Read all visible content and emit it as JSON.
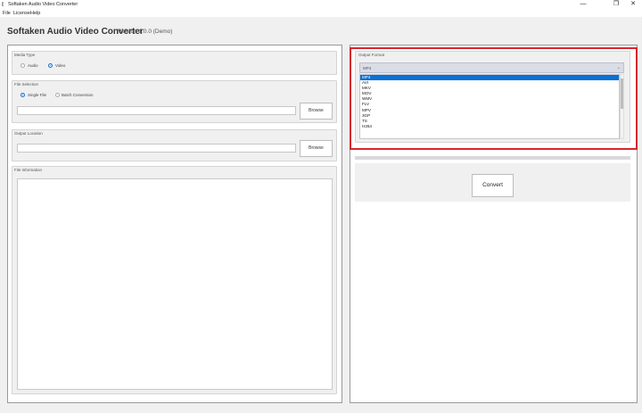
{
  "window": {
    "title": "Softaken Audio Video Converter",
    "minimize_glyph": "—",
    "restore_glyph": "❐",
    "close_glyph": "✕"
  },
  "menu": {
    "items": [
      "File",
      "License",
      "Help"
    ]
  },
  "header": {
    "title": "Softaken Audio Video Converter",
    "version": "Version 1.0.0 (Demo)"
  },
  "media_type": {
    "label": "Media Type",
    "options": [
      "Audio",
      "Video"
    ],
    "selected": "Video"
  },
  "file_selection": {
    "label": "File Selection",
    "options": [
      "Single File",
      "Batch Conversion"
    ],
    "selected": "Single File",
    "path": "",
    "browse_label": "Browse"
  },
  "output_location": {
    "label": "Output Location",
    "path": "",
    "browse_label": "Browse"
  },
  "file_information": {
    "label": "File Information",
    "content": ""
  },
  "output_format": {
    "label": "Output Format",
    "selected": "MP4",
    "options": [
      "MP4",
      "AVI",
      "MKV",
      "MOV",
      "WMV",
      "FLV",
      "MPV",
      "3GP",
      "TS",
      "H264"
    ]
  },
  "actions": {
    "convert_label": "Convert"
  },
  "colors": {
    "highlight": "#d9262c",
    "selection": "#0a6fd6",
    "radio_checked": "#1f6fd1"
  }
}
